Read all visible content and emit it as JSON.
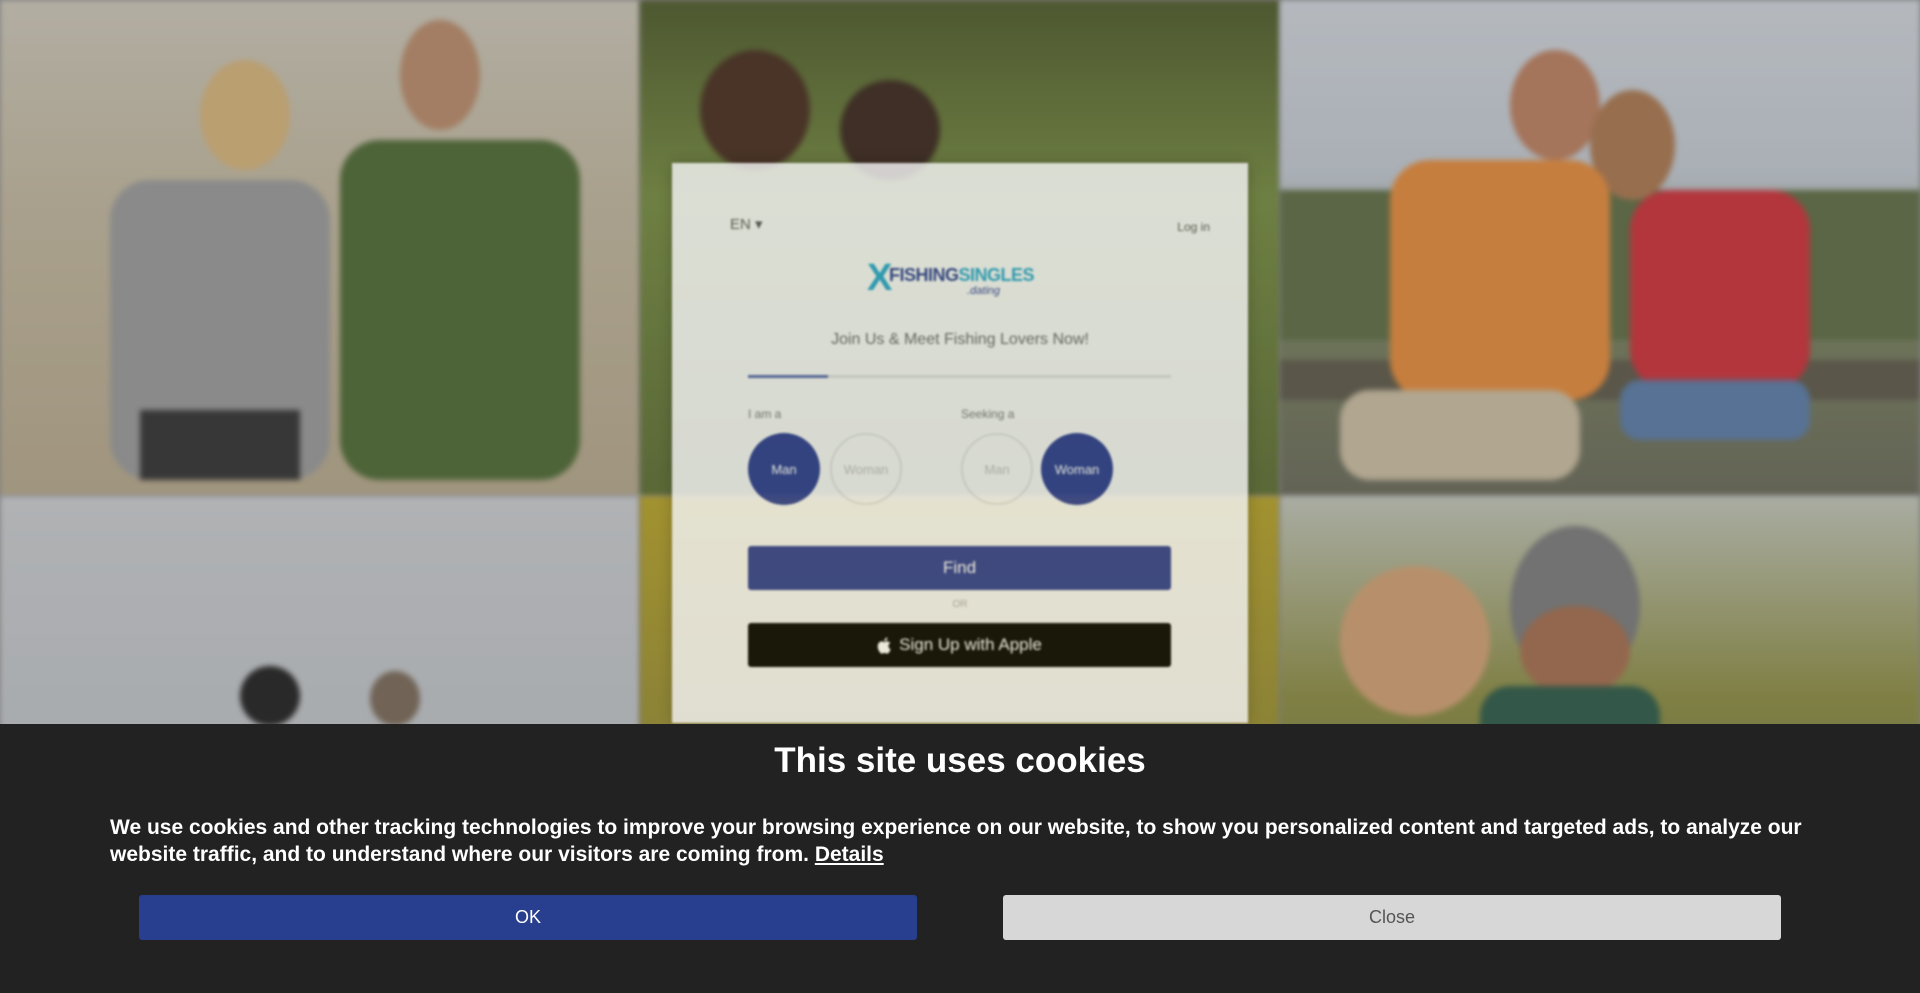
{
  "signup": {
    "language": "EN",
    "login_link": "Log in",
    "logo": {
      "mark": "X",
      "word_primary": "FISHING",
      "word_secondary": "SINGLES",
      "sub": ".dating"
    },
    "tagline": "Join Us & Meet Fishing Lovers Now!",
    "progress": 0.19,
    "i_am_label": "I am a",
    "seeking_label": "Seeking a",
    "i_am_options": [
      {
        "label": "Man",
        "selected": true
      },
      {
        "label": "Woman",
        "selected": false
      }
    ],
    "seeking_options": [
      {
        "label": "Man",
        "selected": false
      },
      {
        "label": "Woman",
        "selected": true
      }
    ],
    "find_button": "Find",
    "or_text": "OR",
    "apple_button": "Sign Up with Apple",
    "apple_icon": "apple-icon"
  },
  "cookie_banner": {
    "title": "This site uses cookies",
    "text": "We use cookies and other tracking technologies to improve your browsing experience on our website, to show you personalized content and targeted ads, to analyze our website traffic, and to understand where our visitors are coming from.",
    "details_link": "Details",
    "ok_button": "OK",
    "close_button": "Close"
  },
  "colors": {
    "accent": "#283f8f",
    "banner_bg": "#222222",
    "close_bg": "#d7d7d7"
  }
}
